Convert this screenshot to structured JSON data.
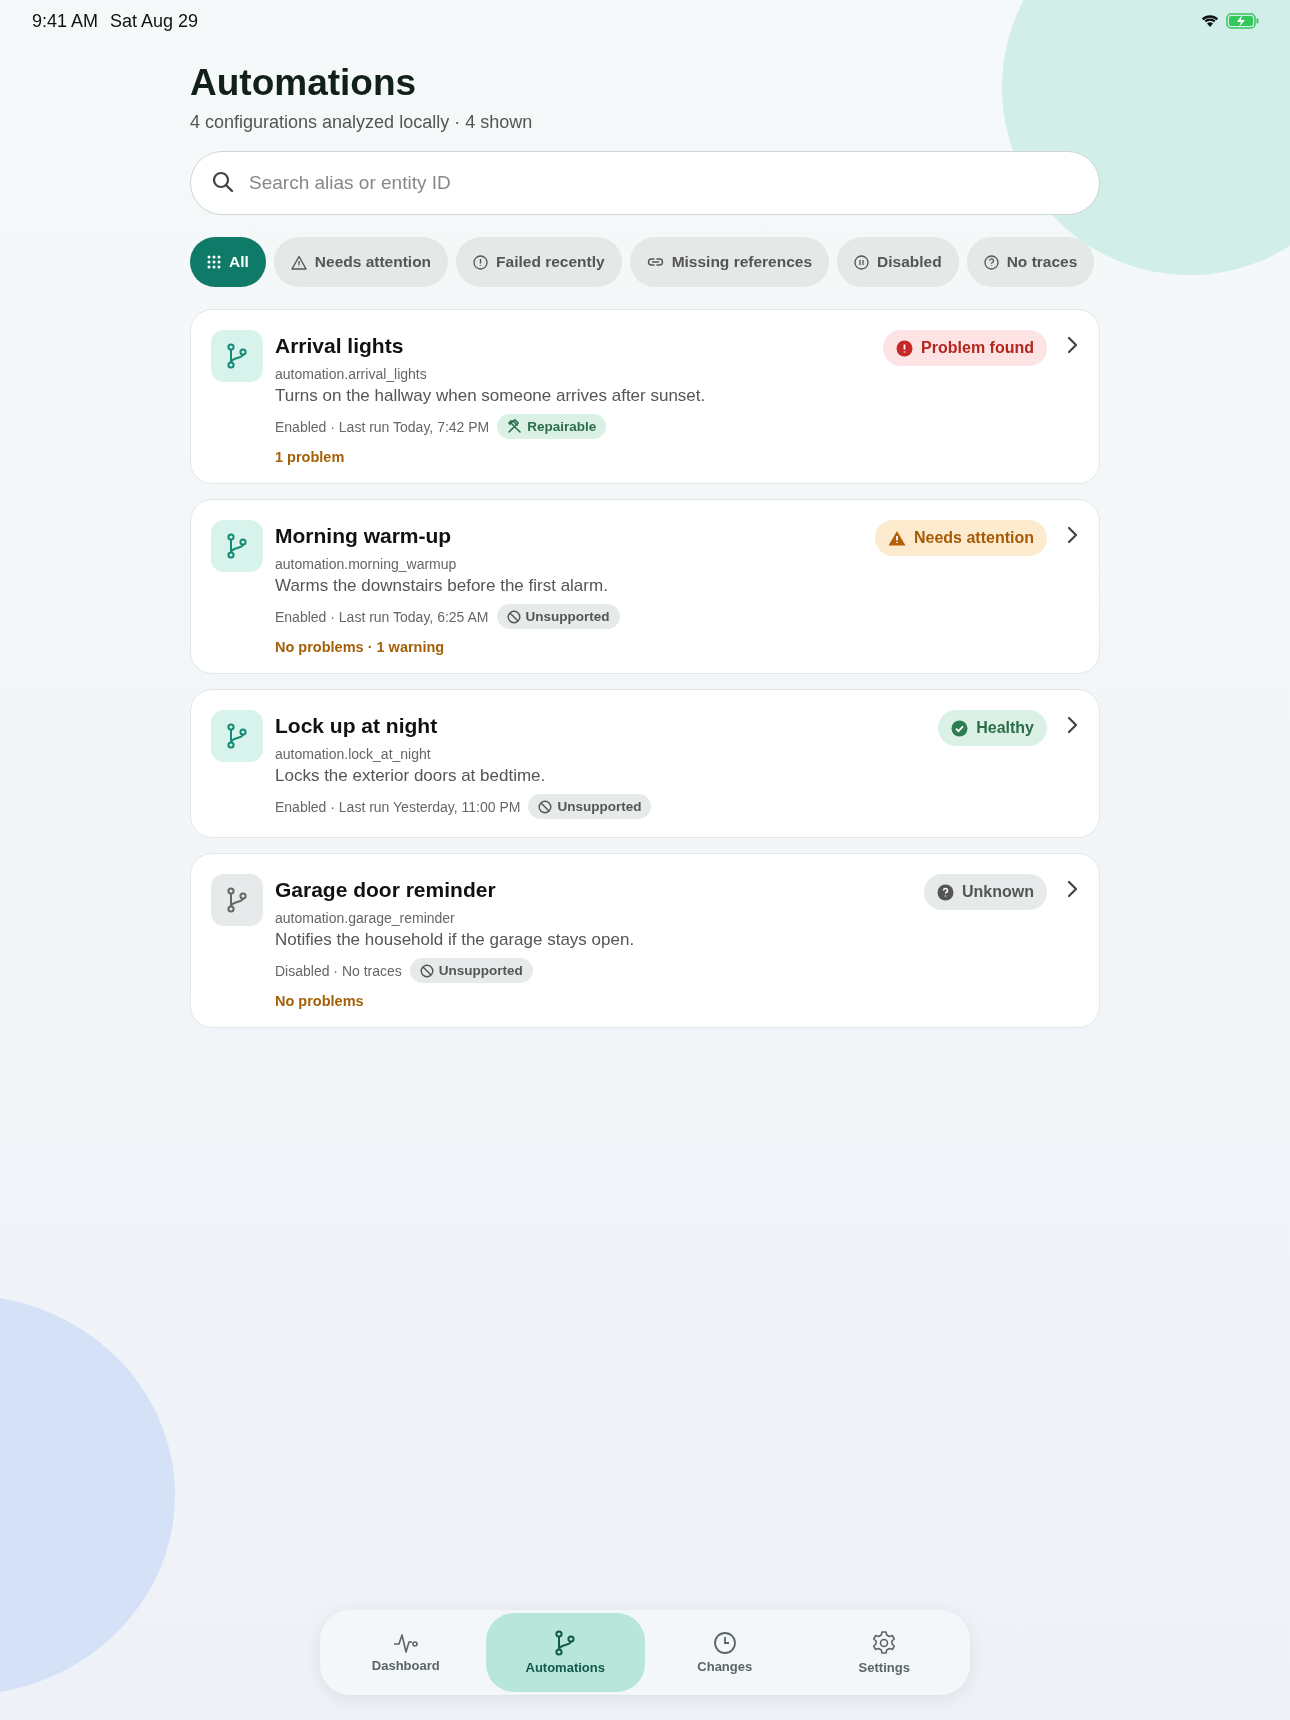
{
  "status_bar": {
    "time": "9:41 AM",
    "date": "Sat Aug 29"
  },
  "header": {
    "title": "Automations",
    "subtitle": "4 configurations analyzed locally · 4 shown"
  },
  "search": {
    "placeholder": "Search alias or entity ID"
  },
  "filters": [
    {
      "kind": "all",
      "label": "All",
      "selected": true
    },
    {
      "kind": "attention",
      "label": "Needs attention",
      "selected": false
    },
    {
      "kind": "failed",
      "label": "Failed recently",
      "selected": false
    },
    {
      "kind": "missing",
      "label": "Missing references",
      "selected": false
    },
    {
      "kind": "disabled",
      "label": "Disabled",
      "selected": false
    },
    {
      "kind": "notraces",
      "label": "No traces",
      "selected": false
    }
  ],
  "automations": [
    {
      "name": "Arrival lights",
      "entity_id": "automation.arrival_lights",
      "description": "Turns on the hallway when someone arrives after sunset.",
      "enabled": true,
      "meta": "Enabled · Last run Today, 7:42 PM",
      "tag": {
        "kind": "repairable",
        "label": "Repairable"
      },
      "status": {
        "kind": "problem",
        "label": "Problem found"
      },
      "summary": "1 problem"
    },
    {
      "name": "Morning warm-up",
      "entity_id": "automation.morning_warmup",
      "description": "Warms the downstairs before the first alarm.",
      "enabled": true,
      "meta": "Enabled · Last run Today, 6:25 AM",
      "tag": {
        "kind": "unsupported",
        "label": "Unsupported"
      },
      "status": {
        "kind": "attention",
        "label": "Needs attention"
      },
      "summary": "No problems · 1 warning"
    },
    {
      "name": "Lock up at night",
      "entity_id": "automation.lock_at_night",
      "description": "Locks the exterior doors at bedtime.",
      "enabled": true,
      "meta": "Enabled · Last run Yesterday, 11:00 PM",
      "tag": {
        "kind": "unsupported",
        "label": "Unsupported"
      },
      "status": {
        "kind": "healthy",
        "label": "Healthy"
      }
    },
    {
      "name": "Garage door reminder",
      "entity_id": "automation.garage_reminder",
      "description": "Notifies the household if the garage stays open.",
      "enabled": false,
      "meta": "Disabled · No traces",
      "tag": {
        "kind": "unsupported",
        "label": "Unsupported"
      },
      "status": {
        "kind": "unknown",
        "label": "Unknown"
      },
      "summary": "No problems"
    }
  ],
  "tab_bar": [
    {
      "kind": "dashboard",
      "label": "Dashboard",
      "selected": false
    },
    {
      "kind": "automations",
      "label": "Automations",
      "selected": true
    },
    {
      "kind": "changes",
      "label": "Changes",
      "selected": false
    },
    {
      "kind": "settings",
      "label": "Settings",
      "selected": false
    }
  ]
}
